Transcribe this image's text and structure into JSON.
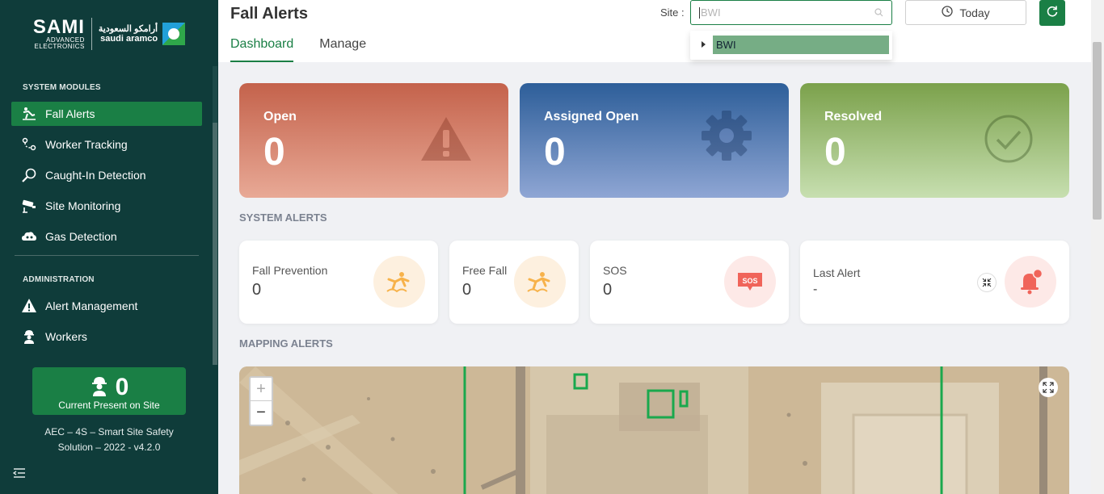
{
  "sidebar": {
    "brand": {
      "name": "SAMI",
      "line1": "ADVANCED",
      "line2": "ELECTRONICS",
      "partner_ar": "أرامكو السعودية",
      "partner_en": "saudi aramco"
    },
    "sections": [
      {
        "label": "SYSTEM MODULES",
        "items": [
          {
            "label": "Fall Alerts",
            "icon": "fall-icon",
            "active": true
          },
          {
            "label": "Worker Tracking",
            "icon": "route-icon"
          },
          {
            "label": "Caught-In Detection",
            "icon": "magnifier-icon"
          },
          {
            "label": "Site Monitoring",
            "icon": "cctv-icon"
          },
          {
            "label": "Gas Detection",
            "icon": "gas-cloud-icon"
          }
        ]
      },
      {
        "label": "ADMINISTRATION",
        "items": [
          {
            "label": "Alert Management",
            "icon": "warning-icon"
          },
          {
            "label": "Workers",
            "icon": "worker-icon"
          }
        ]
      }
    ],
    "present": {
      "count": "0",
      "label": "Current Present on Site"
    },
    "version": "AEC – 4S – Smart Site Safety Solution – 2022 - v4.2.0"
  },
  "header": {
    "title": "Fall Alerts",
    "tabs": [
      "Dashboard",
      "Manage"
    ],
    "site_label": "Site :",
    "site_value": "BWI",
    "site_options": [
      "BWI"
    ],
    "today_label": "Today"
  },
  "cards": {
    "open": {
      "label": "Open",
      "value": "0"
    },
    "assigned": {
      "label": "Assigned Open",
      "value": "0"
    },
    "resolved": {
      "label": "Resolved",
      "value": "0"
    }
  },
  "system_alerts": {
    "title": "SYSTEM ALERTS",
    "fall_prevention": {
      "label": "Fall Prevention",
      "value": "0"
    },
    "free_fall": {
      "label": "Free Fall",
      "value": "0"
    },
    "sos": {
      "label": "SOS",
      "value": "0",
      "icon_text": "SOS"
    },
    "last_alert": {
      "label": "Last Alert",
      "value": "-"
    }
  },
  "mapping": {
    "title": "MAPPING ALERTS",
    "zoom_in": "+",
    "zoom_out": "−"
  },
  "colors": {
    "primary": "#1a7f45",
    "sidebar": "#0f3c3a"
  }
}
